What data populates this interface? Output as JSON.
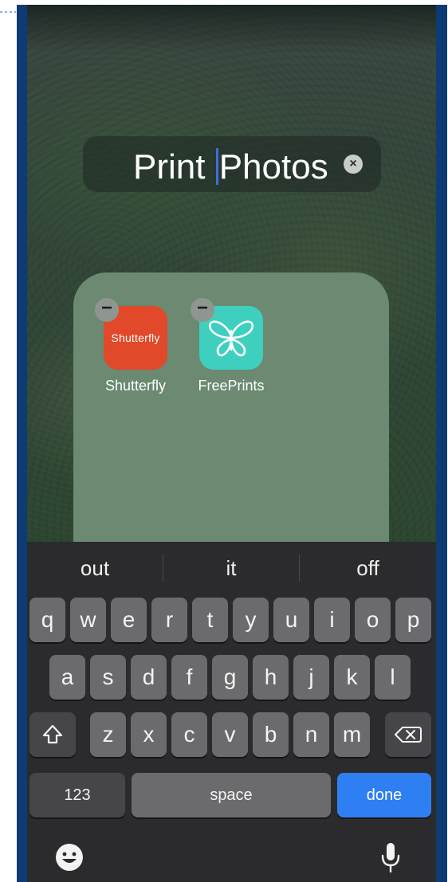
{
  "folder": {
    "name_before_caret": "Print ",
    "name_after_caret": "Photos",
    "clear_icon": "×",
    "apps": [
      {
        "name": "Shutterfly",
        "icon_text": "Shutterfly",
        "icon_color": "#e2482a"
      },
      {
        "name": "FreePrints",
        "icon_color": "#3fcfbf"
      }
    ],
    "remove_badge": "−"
  },
  "keyboard": {
    "suggestions": [
      "out",
      "it",
      "off"
    ],
    "row1": [
      "q",
      "w",
      "e",
      "r",
      "t",
      "y",
      "u",
      "i",
      "o",
      "p"
    ],
    "row2": [
      "a",
      "s",
      "d",
      "f",
      "g",
      "h",
      "j",
      "k",
      "l"
    ],
    "row3": [
      "z",
      "x",
      "c",
      "v",
      "b",
      "n",
      "m"
    ],
    "numbers_label": "123",
    "space_label": "space",
    "done_label": "done",
    "shift_icon": "shift-arrow",
    "delete_icon": "backspace",
    "emoji_icon": "smiley",
    "mic_icon": "microphone"
  },
  "colors": {
    "folder_bg": "#6b8a71",
    "keyboard_bg": "#2b2b2d",
    "key_bg": "#6b6b6d",
    "done_bg": "#2d7ff2",
    "caret": "#3b6fe0"
  }
}
